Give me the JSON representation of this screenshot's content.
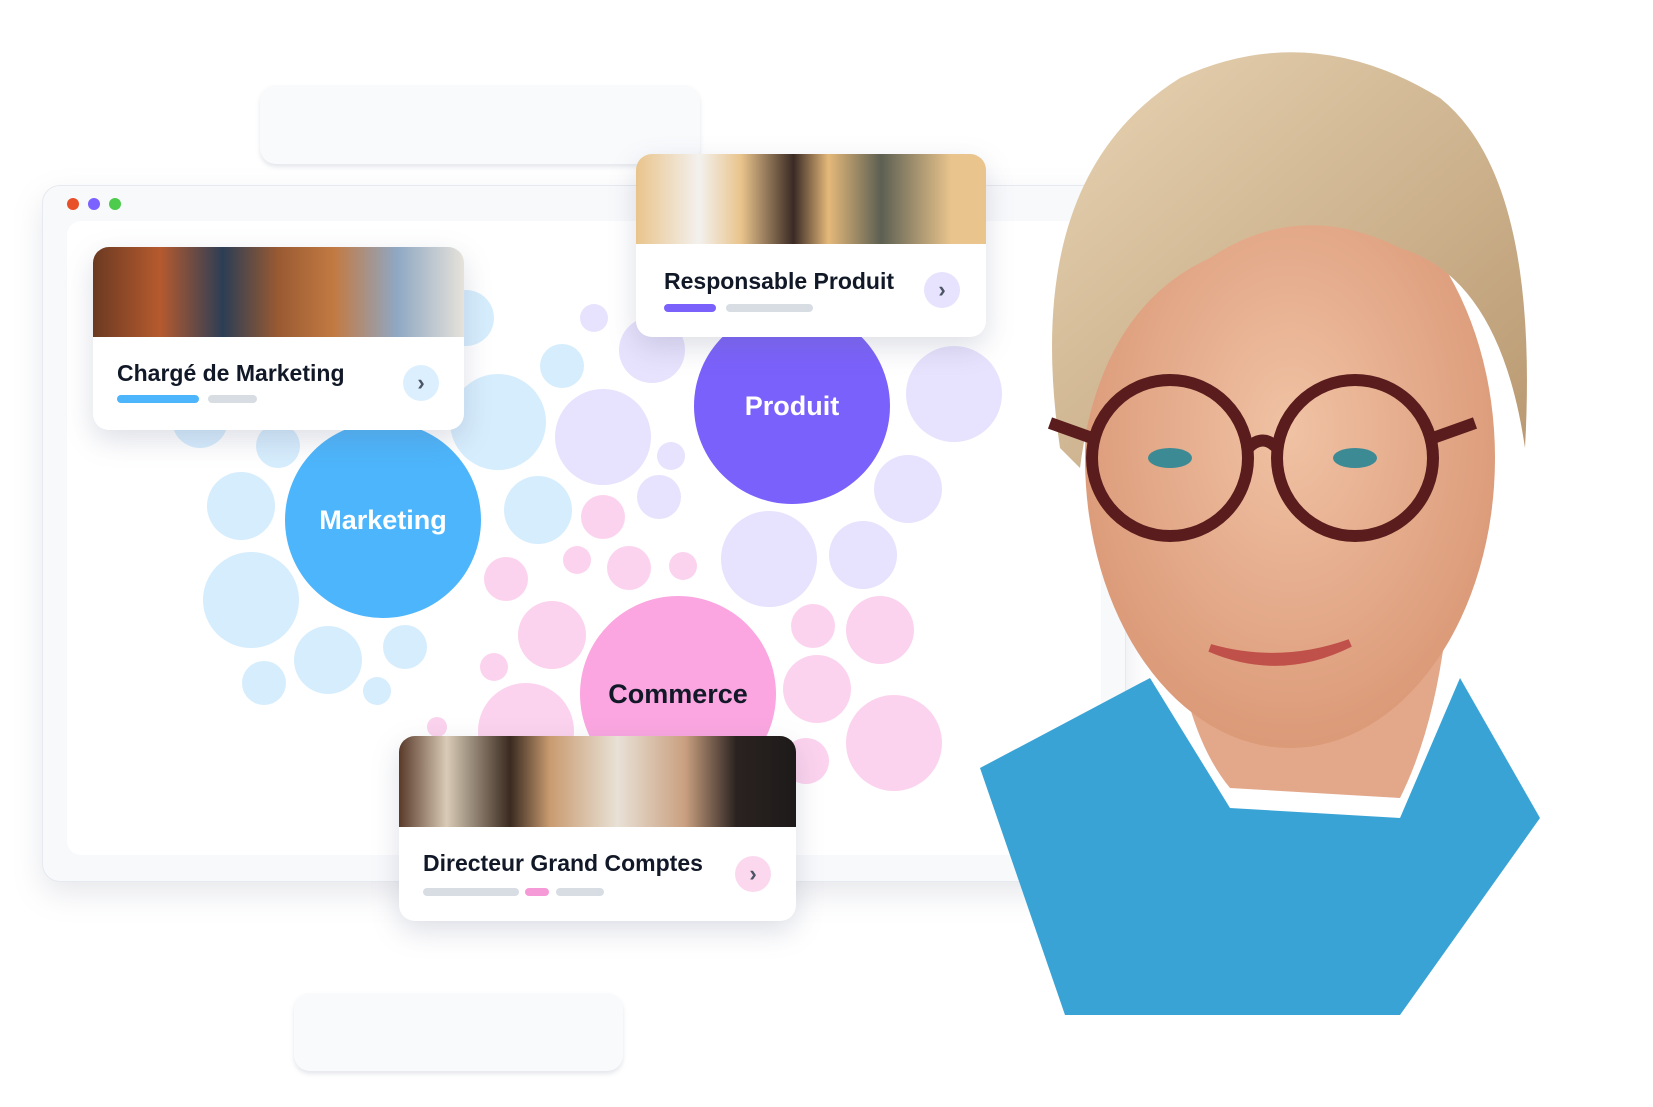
{
  "window_dots": [
    {
      "name": "close",
      "color": "#e8502a"
    },
    {
      "name": "minimize",
      "color": "#7b61ff"
    },
    {
      "name": "maximize",
      "color": "#4ccb4c"
    }
  ],
  "clusters": {
    "marketing": {
      "label": "Marketing",
      "color": "#4db5fb",
      "light": "#d6edfd",
      "text_color": "#ffffff"
    },
    "produit": {
      "label": "Produit",
      "color": "#7b61fb",
      "light": "#e7e2fd",
      "text_color": "#ffffff"
    },
    "commerce": {
      "label": "Commerce",
      "color": "#fba6e0",
      "light": "#fcd3ee",
      "text_color": "#111827"
    }
  },
  "cards": {
    "marketing": {
      "title": "Chargé de Marketing",
      "bar_color": "#4db5fb",
      "arrow_bg": "#dcefff",
      "progress": "1 of 2 steps highlighted"
    },
    "produit": {
      "title": "Responsable Produit",
      "bar_color": "#7b61fb",
      "arrow_bg": "#e7e2fd"
    },
    "commerce": {
      "title": "Directeur Grand Comptes",
      "bar_color": "#f59ad6",
      "arrow_bg": "#fcd8ef"
    }
  }
}
